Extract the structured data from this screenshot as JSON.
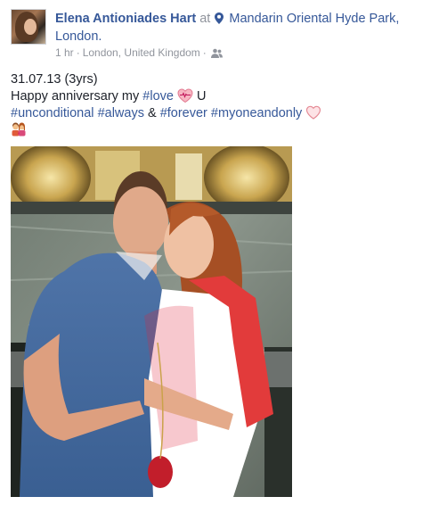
{
  "post": {
    "author": "Elena Antioniades Hart",
    "at_text": "at",
    "location_line1": "Mandarin Oriental Hyde Park,",
    "location_line2": "London.",
    "time": "1 hr",
    "place": "London, United Kingdom",
    "dot": "·",
    "audience_icon": "friends-icon",
    "text_line1": "31.07.13 (3yrs)",
    "text_line2_prefix": "Happy anniversary my ",
    "text_line2_tag": "#love",
    "text_line2_suffix": " U",
    "tag_unconditional": "#unconditional",
    "tag_always": "#always",
    "and_text": " & ",
    "tag_forever": "#forever",
    "tag_myoneandonly": "#myoneandonly",
    "photo_icon": "couple-photo"
  },
  "colors": {
    "link": "#365899",
    "meta": "#90949c",
    "text": "#1d2129"
  }
}
